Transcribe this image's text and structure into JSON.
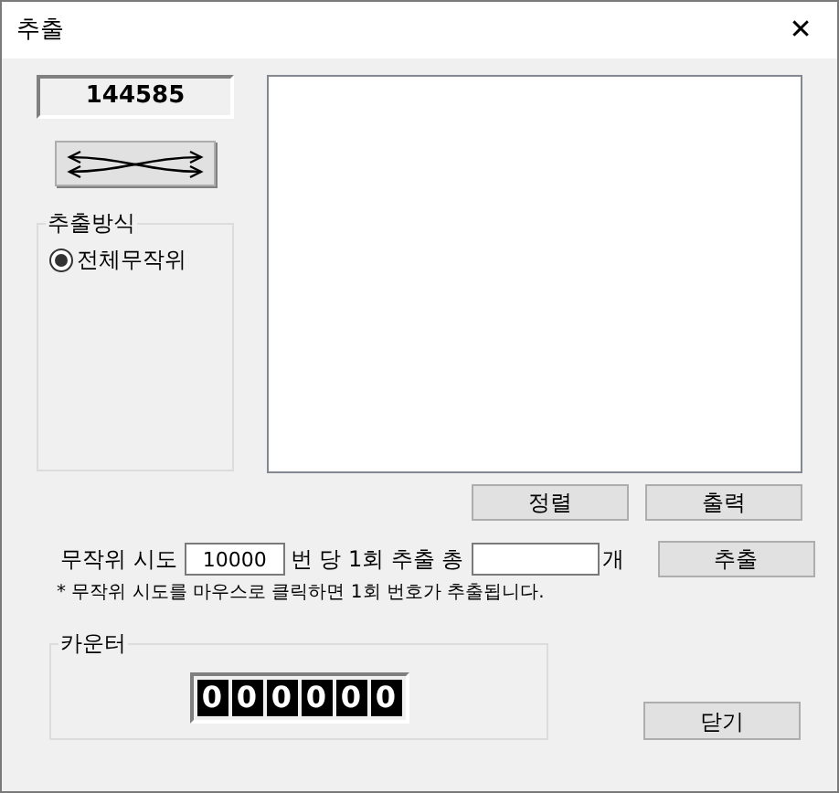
{
  "window": {
    "title": "추출",
    "close": "✕"
  },
  "number_display": "144585",
  "method_group": {
    "title": "추출방식",
    "options": [
      {
        "label": "전체무작위",
        "selected": true
      }
    ]
  },
  "list_buttons": [
    "정렬",
    "출력"
  ],
  "trial_row": {
    "prefix": "무작위 시도",
    "trials": "10000",
    "middle": "번 당 1회 추출 총",
    "suffix": "개",
    "button": "추출"
  },
  "note": "* 무작위 시도를 마우스로 클릭하면 1회 번호가 추출됩니다.",
  "counter_group": {
    "title": "카운터",
    "digits": [
      "0",
      "0",
      "0",
      "0",
      "0",
      "0"
    ]
  },
  "close_button": "닫기"
}
